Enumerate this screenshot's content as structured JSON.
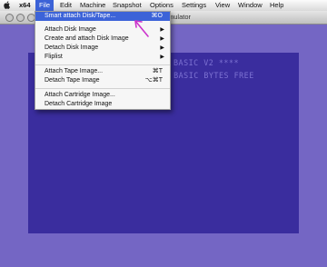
{
  "menubar": {
    "items": [
      {
        "label": "x64"
      },
      {
        "label": "File"
      },
      {
        "label": "Edit"
      },
      {
        "label": "Machine"
      },
      {
        "label": "Snapshot"
      },
      {
        "label": "Options"
      },
      {
        "label": "Settings"
      },
      {
        "label": "View"
      },
      {
        "label": "Window"
      },
      {
        "label": "Help"
      }
    ]
  },
  "window": {
    "title_partial": "mulator"
  },
  "c64": {
    "lines": [
      "BASIC V2 ****",
      "1 BASIC BYTES FREE"
    ]
  },
  "file_menu": {
    "items": [
      {
        "label": "Smart attach Disk/Tape...",
        "shortcut": "⌘O",
        "highlighted": true
      },
      {
        "label": "Attach Disk Image",
        "submenu": true
      },
      {
        "label": "Create and attach Disk Image",
        "submenu": true
      },
      {
        "label": "Detach Disk Image",
        "submenu": true
      },
      {
        "label": "Fliplist",
        "submenu": true
      },
      {
        "label": "Attach Tape Image...",
        "shortcut": "⌘T"
      },
      {
        "label": "Detach Tape Image",
        "shortcut": "⌥⌘T"
      },
      {
        "label": "Attach Cartridge Image..."
      },
      {
        "label": "Detach Cartridge Image"
      }
    ]
  },
  "colors": {
    "menu_highlight": "#3c63d8",
    "c64_border": "#7466c4",
    "c64_screen": "#3a2d9e",
    "c64_text": "#7d72d2",
    "annotation": "#cc33cc"
  }
}
